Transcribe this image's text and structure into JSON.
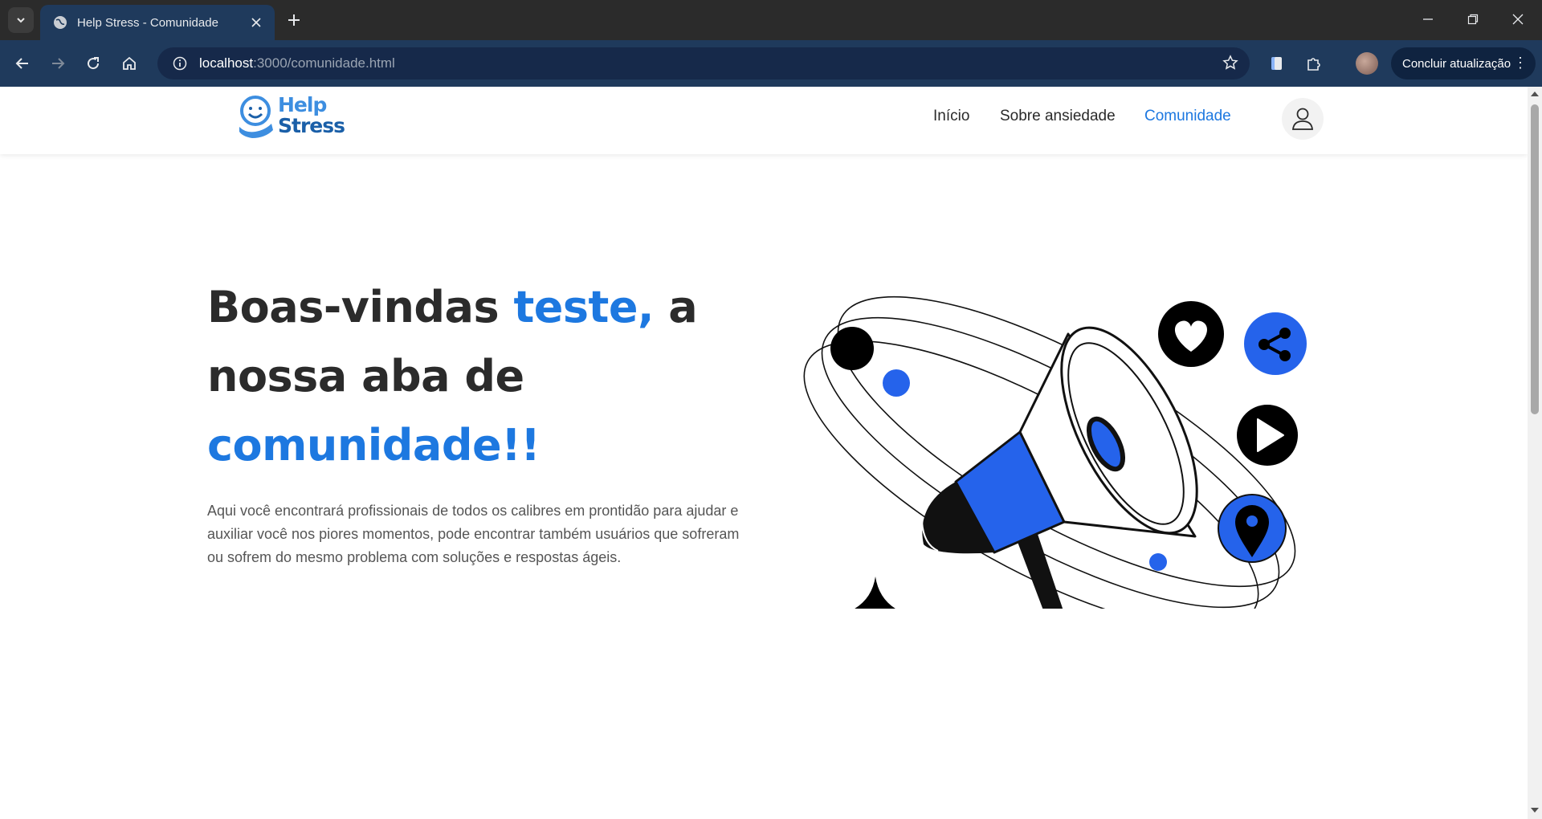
{
  "browser": {
    "tab_title": "Help Stress - Comunidade",
    "url_host": "localhost",
    "url_path": ":3000/comunidade.html",
    "update_label": "Concluir atualização"
  },
  "site": {
    "logo_line1": "Help",
    "logo_line2": "Stress",
    "nav": {
      "inicio": "Início",
      "sobre": "Sobre ansiedade",
      "comunidade": "Comunidade"
    }
  },
  "hero": {
    "title_part1": "Boas-vindas ",
    "title_user": "teste,",
    "title_part2": " a nossa aba de ",
    "title_part3": "comunidade!!",
    "description": "Aqui você encontrará profissionais de todos os calibres em prontidão para ajudar e auxiliar você nos piores momentos, pode encontrar também usuários que sofreram ou sofrem do mesmo problema com soluções e respostas ágeis."
  },
  "colors": {
    "accent": "#1d78e0",
    "illustration_blue": "#2563eb",
    "chrome_bar": "#1f3a5c"
  },
  "icons": [
    "globe-icon",
    "close-icon",
    "plus-icon",
    "back-icon",
    "forward-icon",
    "reload-icon",
    "home-icon",
    "info-icon",
    "star-icon",
    "extension-icon",
    "user-icon",
    "heart-icon",
    "share-icon",
    "play-icon",
    "location-pin-icon"
  ]
}
